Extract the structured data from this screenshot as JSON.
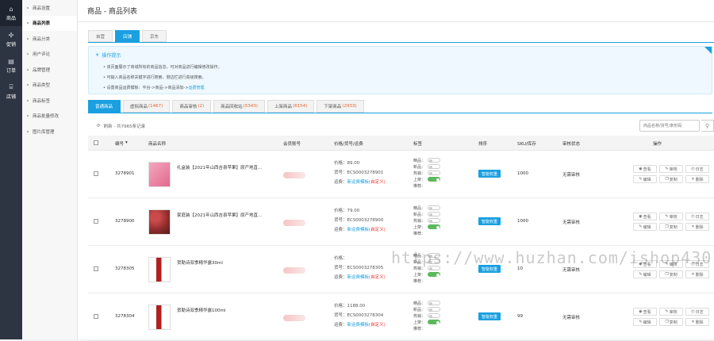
{
  "leftnav": [
    {
      "label": "商品",
      "icon": "home-icon"
    },
    {
      "label": "促销",
      "icon": "promo-icon"
    },
    {
      "label": "订单",
      "icon": "order-icon"
    },
    {
      "label": "店铺",
      "icon": "store-icon"
    }
  ],
  "subnav": [
    "商品设置",
    "商品列表",
    "商品分类",
    "用户评论",
    "品牌管理",
    "商品类型",
    "商品标签",
    "商品批量修改",
    "图片库管理"
  ],
  "page_title": "商品 - 商品列表",
  "source_tabs": [
    "自营",
    "店铺",
    "京东"
  ],
  "tips": {
    "title": "操作提示",
    "lines": [
      "该页面展示了商城所有的商品信息，可对商品进行编辑修改操作。",
      "可输入商品名称关键字进行搜索，侧边栏进行高级搜索。",
      "设置商品运费模板：平台->商品->商品添加->"
    ],
    "link": "运费管理"
  },
  "list_tabs": [
    {
      "label": "普通商品",
      "count": ""
    },
    {
      "label": "虚拟商品",
      "count": "(1467)"
    },
    {
      "label": "商品审核",
      "count": "(2)"
    },
    {
      "label": "商品回收站",
      "count": "(5343)"
    },
    {
      "label": "上架商品",
      "count": "(6154)"
    },
    {
      "label": "下架商品",
      "count": "(2933)"
    }
  ],
  "refresh_text": "刷新 - 共7965条记录",
  "search_placeholder": "商品名称/货号/条形码",
  "columns": [
    "编号",
    "商品名称",
    "会员账号",
    "价格/货号/运费",
    "标签",
    "排序",
    "SKU/库存",
    "审核状态",
    "操作"
  ],
  "tag_labels": [
    "精品：",
    "新品：",
    "热销：",
    "上架：",
    "推荐："
  ],
  "sort_label": "智能权重",
  "op_labels": [
    "查看",
    "审核",
    "日志",
    "编辑",
    "复制",
    "删除"
  ],
  "rows": [
    {
      "id": "3278901",
      "name": "礼盒装【2021年山西吉县苹果】原产地直...",
      "price": "价格：89.00",
      "sku_code": "货号：ECS0003278901",
      "freight": "运费：",
      "freight_link": "新运费模板",
      "freight_note": "(自定义)",
      "stock": "1000",
      "status": "无需审核",
      "on_shelf": 1,
      "thumb": "pink"
    },
    {
      "id": "3278900",
      "name": "家庭装【2021年山西吉县苹果】原产地直...",
      "price": "价格：79.00",
      "sku_code": "货号：ECS0003278900",
      "freight": "运费：",
      "freight_link": "新运费模板",
      "freight_note": "(自定义)",
      "stock": "1000",
      "status": "无需审核",
      "on_shelf": 1,
      "thumb": "apple"
    },
    {
      "id": "3278305",
      "name": "贺勒诗双季精华露30ml",
      "price": "价格：",
      "sku_code": "货号：ECS0003278305",
      "freight": "运费：",
      "freight_link": "新运费模板",
      "freight_note": "(自定义)",
      "stock": "10",
      "status": "无需审核",
      "on_shelf": 1,
      "thumb": "bottle"
    },
    {
      "id": "3278304",
      "name": "贺勒诗双季精华露100ml",
      "price": "价格：1188.00",
      "sku_code": "货号：ECS0003278304",
      "freight": "运费：",
      "freight_link": "新运费模板",
      "freight_note": "(自定义)",
      "stock": "99",
      "status": "无需审核",
      "on_shelf": 1,
      "thumb": "bottle"
    }
  ],
  "watermark": "https://www.huzhan.com/ishop43010",
  "colors": {
    "accent": "#1aa0e0",
    "sidebar": "#2e3542",
    "count": "#e8622c",
    "switch_on": "#5cb85c"
  }
}
